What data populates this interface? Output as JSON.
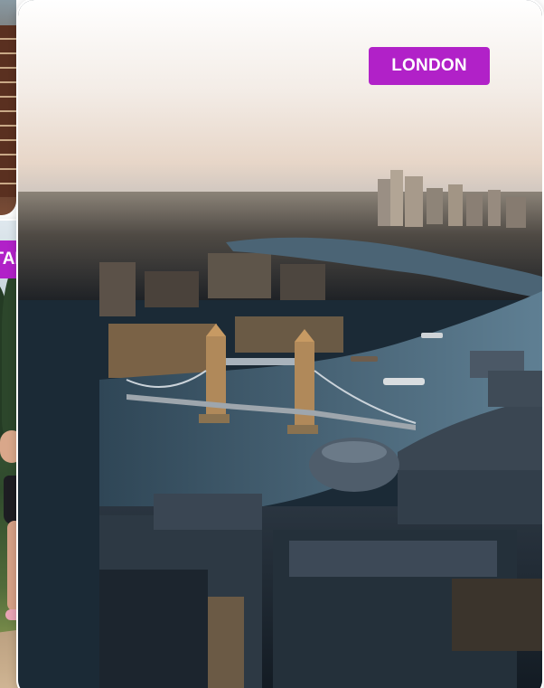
{
  "cards": [
    {
      "city_label": "TAMPERE",
      "photo_icon": "forest-runner-photo",
      "label_color": "#b121c8"
    },
    {
      "city_label": "LONDON",
      "photo_icon": "tower-bridge-aerial-photo",
      "label_color": "#b121c8"
    }
  ]
}
